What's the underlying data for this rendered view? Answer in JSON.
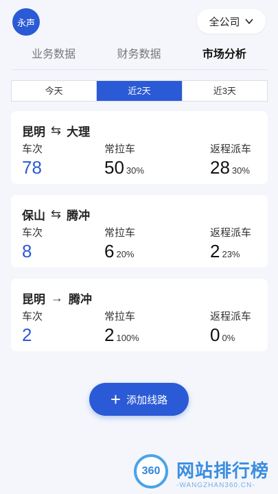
{
  "header": {
    "avatar_text": "永声",
    "company_select": "全公司"
  },
  "tabs": [
    {
      "label": "业务数据"
    },
    {
      "label": "财务数据"
    },
    {
      "label": "市场分析"
    }
  ],
  "period_segments": [
    {
      "label": "今天"
    },
    {
      "label": "近2天"
    },
    {
      "label": "近3天"
    }
  ],
  "labels": {
    "trips": "车次",
    "regular": "常拉车",
    "return": "返程派车"
  },
  "routes": [
    {
      "from": "昆明",
      "arrow": "⇆",
      "to": "大理",
      "trips": "78",
      "regular": "50",
      "regular_pct": "30%",
      "return": "28",
      "return_pct": "30%"
    },
    {
      "from": "保山",
      "arrow": "⇆",
      "to": "腾冲",
      "trips": "8",
      "regular": "6",
      "regular_pct": "20%",
      "return": "2",
      "return_pct": "23%"
    },
    {
      "from": "昆明",
      "arrow": "→",
      "to": "腾冲",
      "trips": "2",
      "regular": "2",
      "regular_pct": "100%",
      "return": "0",
      "return_pct": "0%"
    }
  ],
  "add_button": {
    "label": "添加线路",
    "icon": "plus-icon"
  },
  "watermark": {
    "logo": "360",
    "title": "网站排行榜",
    "subtitle": "-WANGZHAN360.CN-"
  },
  "colors": {
    "accent": "#2b5ad6",
    "background": "#f4f6fb"
  }
}
